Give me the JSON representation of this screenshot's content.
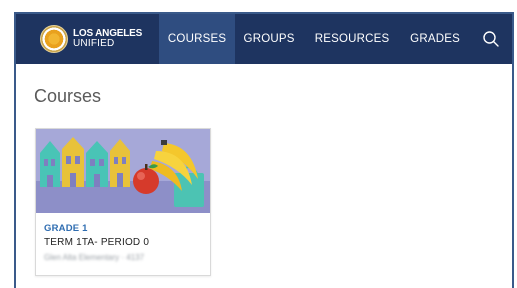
{
  "brand": {
    "line1": "LOS ANGELES",
    "line2": "UNIFIED",
    "color": "#1e3460"
  },
  "nav": {
    "items": [
      {
        "id": "courses",
        "label": "COURSES",
        "active": true
      },
      {
        "id": "groups",
        "label": "GROUPS",
        "active": false
      },
      {
        "id": "resources",
        "label": "RESOURCES",
        "active": false
      },
      {
        "id": "grades",
        "label": "GRADES",
        "active": false
      }
    ],
    "search_icon": "search-icon"
  },
  "page": {
    "title": "Courses"
  },
  "courses": [
    {
      "grade": "GRADE 1",
      "title": "TERM 1TA- PERIOD 0",
      "school": "Glen Alta Elementary · 4137"
    }
  ],
  "colors": {
    "accent": "#2f6db1",
    "nav_active": "#2f4d80"
  }
}
